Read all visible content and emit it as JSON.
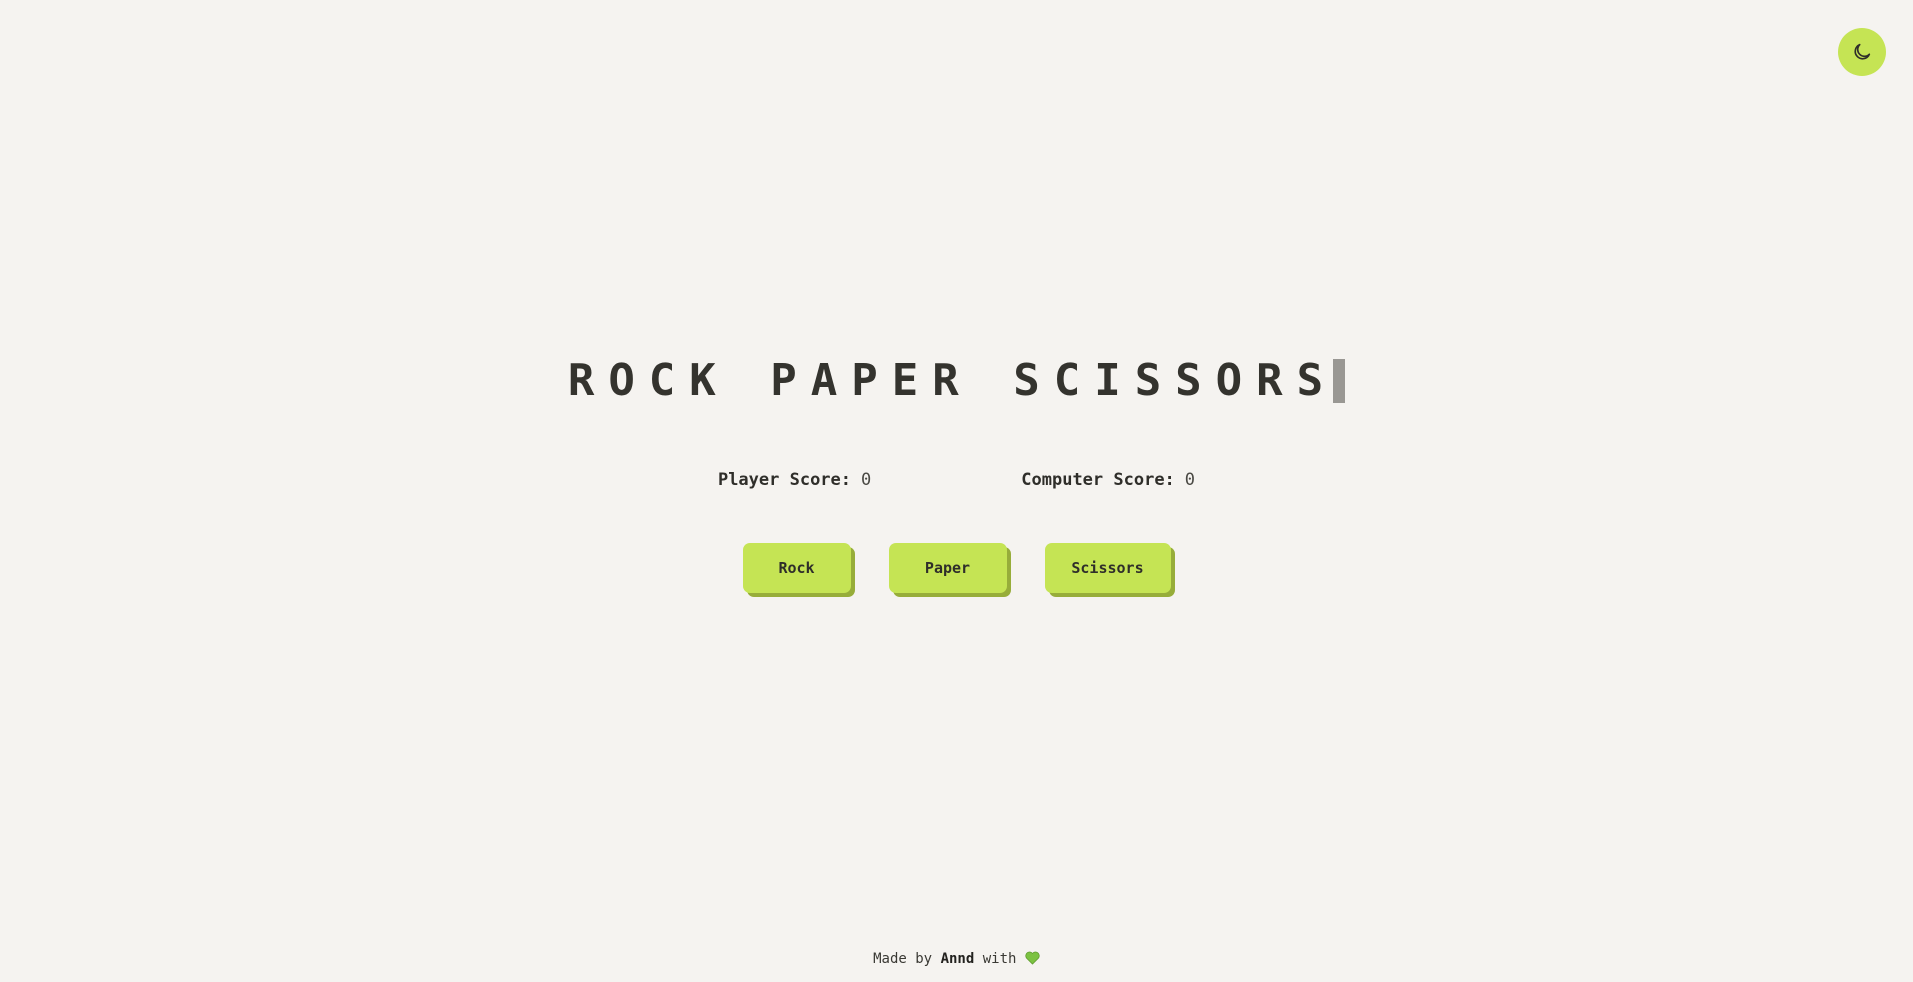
{
  "theme_toggle": {
    "icon": "moon-icon",
    "color": "#c5e454"
  },
  "title": {
    "text": "ROCK PAPER SCISSORS"
  },
  "scores": {
    "player_label": "Player Score:",
    "player_value": "0",
    "computer_label": "Computer Score:",
    "computer_value": "0"
  },
  "choices": {
    "rock_label": "Rock",
    "paper_label": "Paper",
    "scissors_label": "Scissors"
  },
  "footer": {
    "prefix": "Made by",
    "author": "Annd",
    "suffix": "with",
    "icon": "green-heart-icon"
  },
  "colors": {
    "background": "#f5f3f0",
    "accent": "#c5e454",
    "accent_shadow": "#97ad3a",
    "text": "#2f2e2a"
  }
}
